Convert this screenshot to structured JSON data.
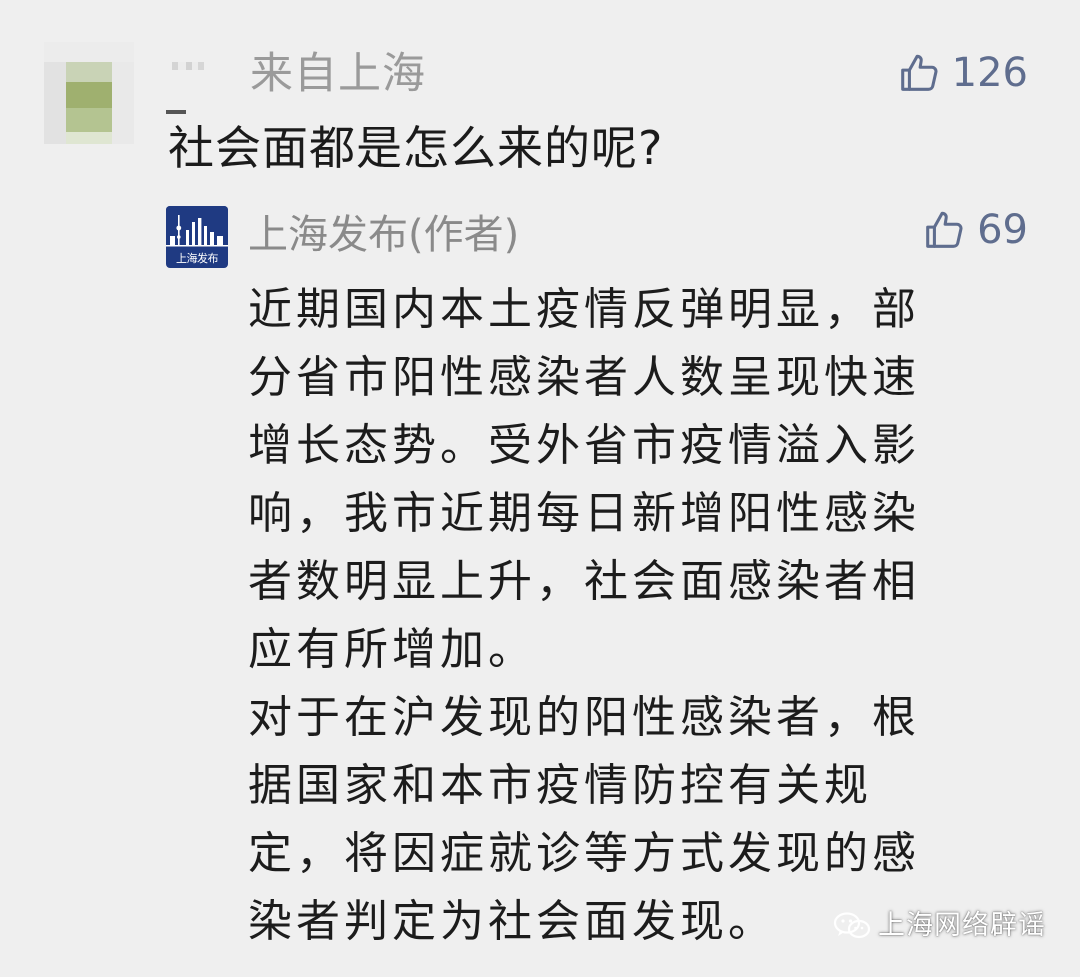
{
  "comment": {
    "location": "来自上海",
    "likes": "126",
    "text": "社会面都是怎么来的呢?"
  },
  "reply": {
    "logo_text": "上海发布",
    "author": "上海发布(作者)",
    "likes": "69",
    "paragraphs": [
      {
        "lines": [
          "近期国内本土疫情反弹明显，部",
          "分省市阳性感染者人数呈现快速",
          "增长态势。受外省市疫情溢入影",
          "响，我市近期每日新增阳性感染",
          "者数明显上升，社会面感染者相",
          "应有所增加。"
        ]
      },
      {
        "lines": [
          "对于在沪发现的阳性感染者，根",
          "据国家和本市疫情防控有关规",
          "定，将因症就诊等方式发现的感",
          "染者判定为社会面发现。"
        ]
      }
    ]
  },
  "watermark": {
    "text": "上海网络辟谣",
    "icon": "wechat-icon"
  },
  "colors": {
    "background": "#efefef",
    "like_blue": "#5f6d8e",
    "logo_blue": "#1f3a82",
    "secondary_text": "#9a9a9a",
    "primary_text": "#1c1c1c"
  }
}
